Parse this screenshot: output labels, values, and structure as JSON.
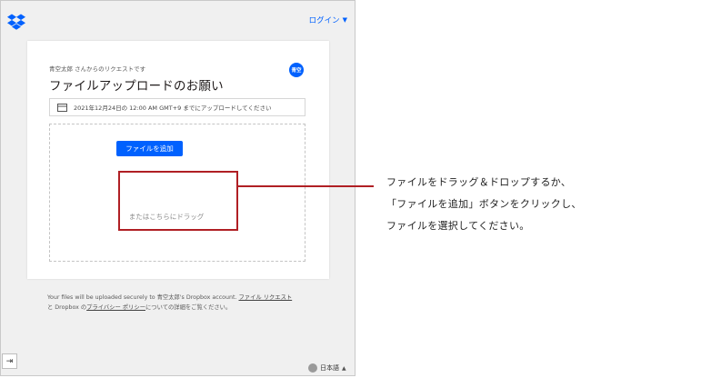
{
  "header": {
    "login_label": "ログイン"
  },
  "card": {
    "requester": "青空太郎 さんからのリクエストです",
    "title": "ファイルアップロードのお願い",
    "avatar_text": "青空",
    "deadline": "2021年12月24日の 12:00 AM GMT+9 までにアップロードしてください",
    "add_button": "ファイルを追加",
    "drag_hint": "またはこちらにドラッグ"
  },
  "footer": {
    "line1_text": "Your files will be uploaded securely to 青空太郎's Dropbox account.",
    "file_request_link": "ファイル リクエスト",
    "line2_text": "と Dropbox の",
    "privacy_link": "プライバシー ポリシー",
    "line2_rest": "についての詳細をご覧ください。"
  },
  "language": {
    "label": "日本語"
  },
  "annotation": {
    "lines": [
      "ファイルをドラッグ＆ドロップするか、",
      "「ファイルを追加」ボタンをクリックし、",
      "ファイルを選択してください。"
    ]
  },
  "colors": {
    "accent": "#0061fe",
    "highlight": "#b01f24"
  },
  "icons": [
    "dropbox-logo",
    "calendar-icon",
    "globe-icon",
    "sidebar-expand-icon"
  ]
}
